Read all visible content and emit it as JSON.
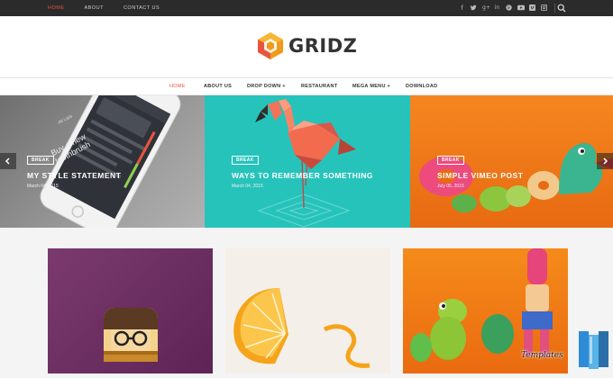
{
  "topbar": {
    "nav": [
      {
        "label": "HOME",
        "active": true
      },
      {
        "label": "ABOUT",
        "active": false
      },
      {
        "label": "CONTACT US",
        "active": false
      }
    ],
    "social_icons": [
      "facebook-icon",
      "twitter-icon",
      "google-plus-icon",
      "linkedin-icon",
      "pinterest-icon",
      "youtube-icon",
      "vimeo-icon",
      "instagram-icon"
    ]
  },
  "header": {
    "logo_text": "GRIDZ",
    "accent_color": "#e8553f"
  },
  "mainnav": {
    "items": [
      {
        "label": "HOME",
        "active": true
      },
      {
        "label": "ABOUT US",
        "active": false
      },
      {
        "label": "DROP DOWN +",
        "active": false
      },
      {
        "label": "RESTAURANT",
        "active": false
      },
      {
        "label": "MEGA MENU +",
        "active": false
      },
      {
        "label": "DOWNLOAD",
        "active": false
      }
    ]
  },
  "slider": {
    "slides": [
      {
        "tag": "BREAK",
        "title": "MY STYLE STATEMENT",
        "date": "March 04, 2015",
        "phone_text": "Buy a new toothbrush",
        "phone_header": "All Lists"
      },
      {
        "tag": "BREAK",
        "title": "WAYS TO REMEMBER SOMETHING",
        "date": "March 04, 2015"
      },
      {
        "tag": "BREAK",
        "title": "SIMPLE VIMEO POST",
        "date": "July 05, 2015"
      }
    ]
  },
  "watermark": {
    "text": "Templates"
  }
}
